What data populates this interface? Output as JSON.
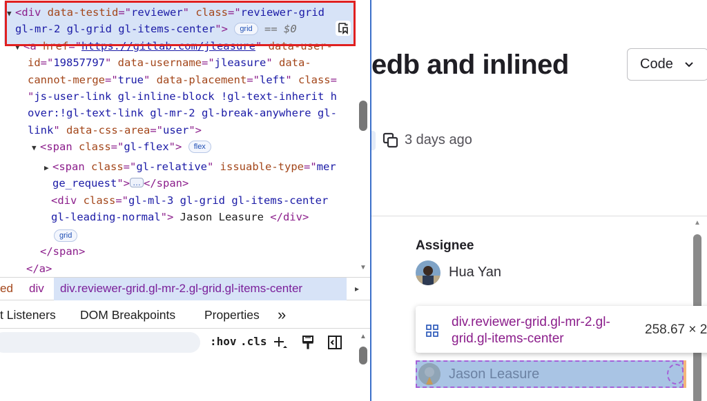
{
  "elements": {
    "lines": [
      [
        [
          "tag",
          "<div "
        ],
        [
          "attr",
          "data-testid"
        ],
        [
          "tag",
          "=\""
        ],
        [
          "val",
          "reviewer"
        ],
        [
          "tag",
          "\" "
        ],
        [
          "attr",
          "class"
        ],
        [
          "tag",
          "=\""
        ],
        [
          "val",
          "reviewer-grid"
        ]
      ],
      [
        [
          "val",
          "gl-mr-2 gl-grid gl-items-center"
        ],
        [
          "tag",
          "\">"
        ]
      ],
      [
        [
          "tag",
          "<a "
        ],
        [
          "attr",
          "href"
        ],
        [
          "tag",
          "=\""
        ],
        [
          "link",
          "https://gitlab.com/jleasure"
        ],
        [
          "tag",
          "\" "
        ],
        [
          "attr",
          "data-user-"
        ]
      ],
      [
        [
          "attr",
          "id"
        ],
        [
          "tag",
          "=\""
        ],
        [
          "val",
          "19857797"
        ],
        [
          "tag",
          "\" "
        ],
        [
          "attr",
          "data-username"
        ],
        [
          "tag",
          "=\""
        ],
        [
          "val",
          "jleasure"
        ],
        [
          "tag",
          "\" "
        ],
        [
          "attr",
          "data-"
        ]
      ],
      [
        [
          "attr",
          "cannot-merge"
        ],
        [
          "tag",
          "=\""
        ],
        [
          "val",
          "true"
        ],
        [
          "tag",
          "\" "
        ],
        [
          "attr",
          "data-placement"
        ],
        [
          "tag",
          "=\""
        ],
        [
          "val",
          "left"
        ],
        [
          "tag",
          "\" "
        ],
        [
          "attr",
          "class"
        ],
        [
          "tag",
          "="
        ]
      ],
      [
        [
          "tag",
          "\""
        ],
        [
          "val",
          "js-user-link gl-inline-block !gl-text-inherit h"
        ]
      ],
      [
        [
          "val",
          "over:!gl-text-link gl-mr-2 gl-break-anywhere gl-"
        ]
      ],
      [
        [
          "val",
          "link"
        ],
        [
          "tag",
          "\" "
        ],
        [
          "attr",
          "data-css-area"
        ],
        [
          "tag",
          "=\""
        ],
        [
          "val",
          "user"
        ],
        [
          "tag",
          "\">"
        ]
      ],
      [
        [
          "tag",
          "<span "
        ],
        [
          "attr",
          "class"
        ],
        [
          "tag",
          "=\""
        ],
        [
          "val",
          "gl-flex"
        ],
        [
          "tag",
          "\">"
        ]
      ],
      [
        [
          "tag",
          "<span "
        ],
        [
          "attr",
          "class"
        ],
        [
          "tag",
          "=\""
        ],
        [
          "val",
          "gl-relative"
        ],
        [
          "tag",
          "\" "
        ],
        [
          "attr",
          "issuable-type"
        ],
        [
          "tag",
          "=\""
        ],
        [
          "val",
          "mer"
        ]
      ],
      [
        [
          "val",
          "ge_request"
        ],
        [
          "tag",
          "\">"
        ]
      ],
      [
        [
          "tag",
          "<div "
        ],
        [
          "attr",
          "class"
        ],
        [
          "tag",
          "=\""
        ],
        [
          "val",
          "gl-ml-3 gl-grid gl-items-center"
        ]
      ],
      [
        [
          "val",
          "gl-leading-normal"
        ],
        [
          "tag",
          "\">"
        ],
        [
          "txt",
          " Jason Leasure "
        ],
        [
          "tag",
          "</div>"
        ]
      ],
      [],
      [
        [
          "tag",
          "</span>"
        ]
      ],
      [
        [
          "tag",
          "</a>"
        ]
      ]
    ],
    "badge_grid": "grid",
    "badge_flex": "flex",
    "badge_grid_2": "grid",
    "eq_hint": "== $0",
    "span_close": "</span>",
    "ellipsis": "…"
  },
  "breadcrumbs": {
    "prev": "ed",
    "div": "div",
    "active": "div.reviewer-grid.gl-mr-2.gl-grid.gl-items-center",
    "more": "▸"
  },
  "tabs": {
    "event_listeners": "t Listeners",
    "dom_breakpoints": "DOM Breakpoints",
    "properties": "Properties",
    "more": "»"
  },
  "styles_toolbar": {
    "hov": ":hov",
    "cls": ".cls"
  },
  "page": {
    "title": "edb and inlined",
    "code_button": "Code",
    "timeago": "3 days ago",
    "assignee_label": "Assignee",
    "assignee_name": "Hua Yan",
    "reviewer_name": "Jason Leasure"
  },
  "tooltip": {
    "selector": "div.reviewer-grid.gl-mr-2.gl-grid.gl-items-center",
    "dimensions": "258.67 × 2"
  },
  "colors": {
    "tag": "#8b1d8b",
    "attribute": "#a3461a",
    "value": "#1a1aa6",
    "selection": "#d7e3f7",
    "outline": "#e02020",
    "highlight_content": "#a9c4e4",
    "highlight_dash": "#a460d8"
  }
}
